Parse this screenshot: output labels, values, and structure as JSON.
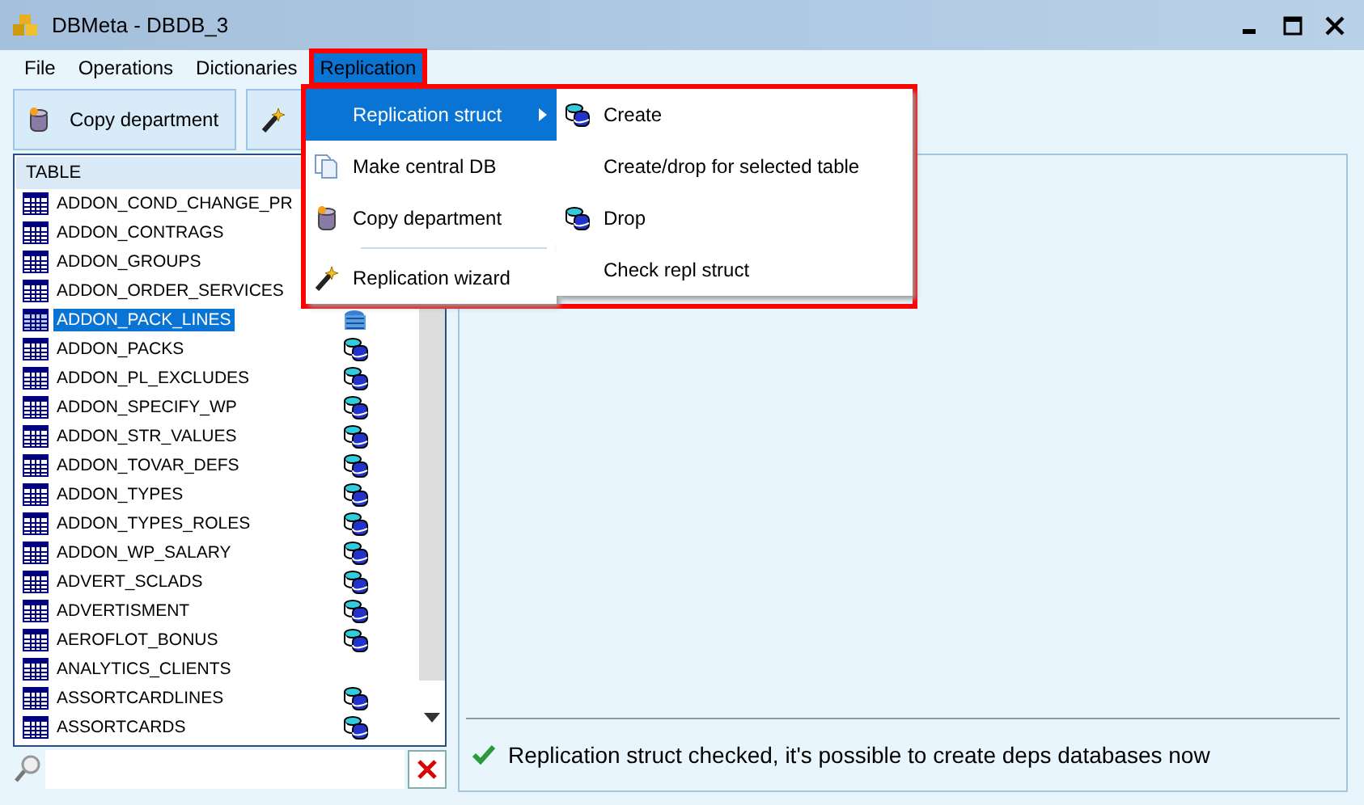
{
  "window": {
    "title": "DBMeta - DBDB_3"
  },
  "menu_bar": [
    {
      "label": "File",
      "selected": false
    },
    {
      "label": "Operations",
      "selected": false
    },
    {
      "label": "Dictionaries",
      "selected": false
    },
    {
      "label": "Replication",
      "selected": true
    }
  ],
  "toolbar": [
    {
      "label": "Copy department",
      "kind": "copy"
    },
    {
      "kind": "wizard"
    }
  ],
  "table_list": {
    "header": "TABLE",
    "rows": [
      {
        "name": "ADDON_COND_CHANGE_PR",
        "selected": false
      },
      {
        "name": "ADDON_CONTRAGS",
        "selected": false
      },
      {
        "name": "ADDON_GROUPS",
        "selected": false
      },
      {
        "name": "ADDON_ORDER_SERVICES",
        "selected": false
      },
      {
        "name": "ADDON_PACK_LINES",
        "selected": true,
        "replicated": true
      },
      {
        "name": "ADDON_PACKS",
        "selected": false,
        "replicated": true
      },
      {
        "name": "ADDON_PL_EXCLUDES",
        "selected": false,
        "replicated": true
      },
      {
        "name": "ADDON_SPECIFY_WP",
        "selected": false,
        "replicated": true
      },
      {
        "name": "ADDON_STR_VALUES",
        "selected": false,
        "replicated": true
      },
      {
        "name": "ADDON_TOVAR_DEFS",
        "selected": false,
        "replicated": true
      },
      {
        "name": "ADDON_TYPES",
        "selected": false,
        "replicated": true
      },
      {
        "name": "ADDON_TYPES_ROLES",
        "selected": false,
        "replicated": true
      },
      {
        "name": "ADDON_WP_SALARY",
        "selected": false,
        "replicated": true
      },
      {
        "name": "ADVERT_SCLADS",
        "selected": false,
        "replicated": true
      },
      {
        "name": "ADVERTISMENT",
        "selected": false,
        "replicated": true
      },
      {
        "name": "AEROFLOT_BONUS",
        "selected": false,
        "replicated": true
      },
      {
        "name": "ANALYTICS_CLIENTS",
        "selected": false,
        "replicated": false
      },
      {
        "name": "ASSORTCARDLINES",
        "selected": false,
        "replicated": true
      },
      {
        "name": "ASSORTCARDS",
        "selected": false,
        "replicated": true
      }
    ]
  },
  "replication_menu": [
    {
      "label": "Replication struct",
      "kind": "none",
      "selected": true,
      "submenu": true
    },
    {
      "label": "Make central DB",
      "kind": "pages",
      "selected": false,
      "submenu": false
    },
    {
      "label": "Copy department",
      "kind": "copy",
      "selected": false,
      "submenu": false
    },
    {
      "label": "Replication wizard",
      "kind": "wizard",
      "selected": false,
      "submenu": false
    }
  ],
  "submenu": [
    {
      "label": "Create",
      "kind": "db"
    },
    {
      "label": "Create/drop for selected table",
      "kind": "none"
    },
    {
      "label": "Drop",
      "kind": "db"
    },
    {
      "label": "Check repl struct",
      "kind": "none"
    }
  ],
  "status": {
    "message": "Replication struct checked, it's possible to create deps databases now"
  }
}
